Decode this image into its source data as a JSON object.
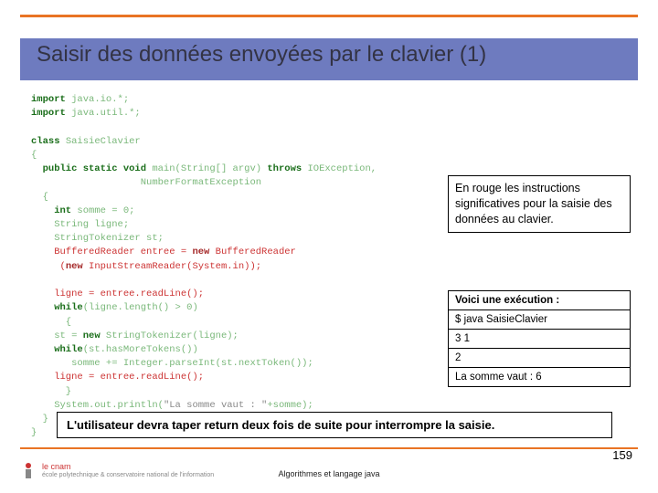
{
  "title": "Saisir des données envoyées par le clavier  (1)",
  "code": {
    "l01a": "import",
    "l01b": " java.io.*;",
    "l02a": "import",
    "l02b": " java.util.*;",
    "l03a": "class",
    "l03b": " SaisieClavier",
    "l04": "{",
    "l05a": "  public static void",
    "l05b": " main(String[] argv) ",
    "l05c": "throws",
    "l05d": " IOException,",
    "l06": "                   NumberFormatException",
    "l07": "  {",
    "l08a": "    int",
    "l08b": " somme = 0;",
    "l09": "    String ligne;",
    "l10": "    StringTokenizer st;",
    "l11a": "    BufferedReader entree = ",
    "l11b": "new",
    "l11c": " BufferedReader",
    "l12a": "     (",
    "l12b": "new",
    "l12c": " InputStreamReader(System.in));",
    "l13": "",
    "l14": "    ligne = entree.readLine();",
    "l15a": "    while",
    "l15b": "(ligne.length() > 0)",
    "l16": "      {",
    "l17a": "    st = ",
    "l17b": "new",
    "l17c": " StringTokenizer(ligne);",
    "l18a": "    while",
    "l18b": "(st.hasMoreTokens())",
    "l19": "       somme += Integer.parseInt(st.nextToken());",
    "l20": "    ligne = entree.readLine();",
    "l21": "      }",
    "l22a": "    System.out.println(",
    "l22b": "\"La somme vaut : \"",
    "l22c": "+somme);",
    "l23": "  }",
    "l24": "}"
  },
  "note": "En rouge les instructions significatives pour la saisie des données au clavier.",
  "exec": {
    "header": "Voici une exécution :",
    "r1": "$ java SaisieClavier",
    "r2": "3 1",
    "r3": "2",
    "r4": " La somme vaut : 6"
  },
  "bottom_note": "L'utilisateur devra taper return deux fois de suite pour interrompre la saisie.",
  "page_number": "159",
  "footer": "Algorithmes et langage java",
  "logo": {
    "main": "le cnam",
    "sub": "école polytechnique & conservatoire national de l'information"
  }
}
